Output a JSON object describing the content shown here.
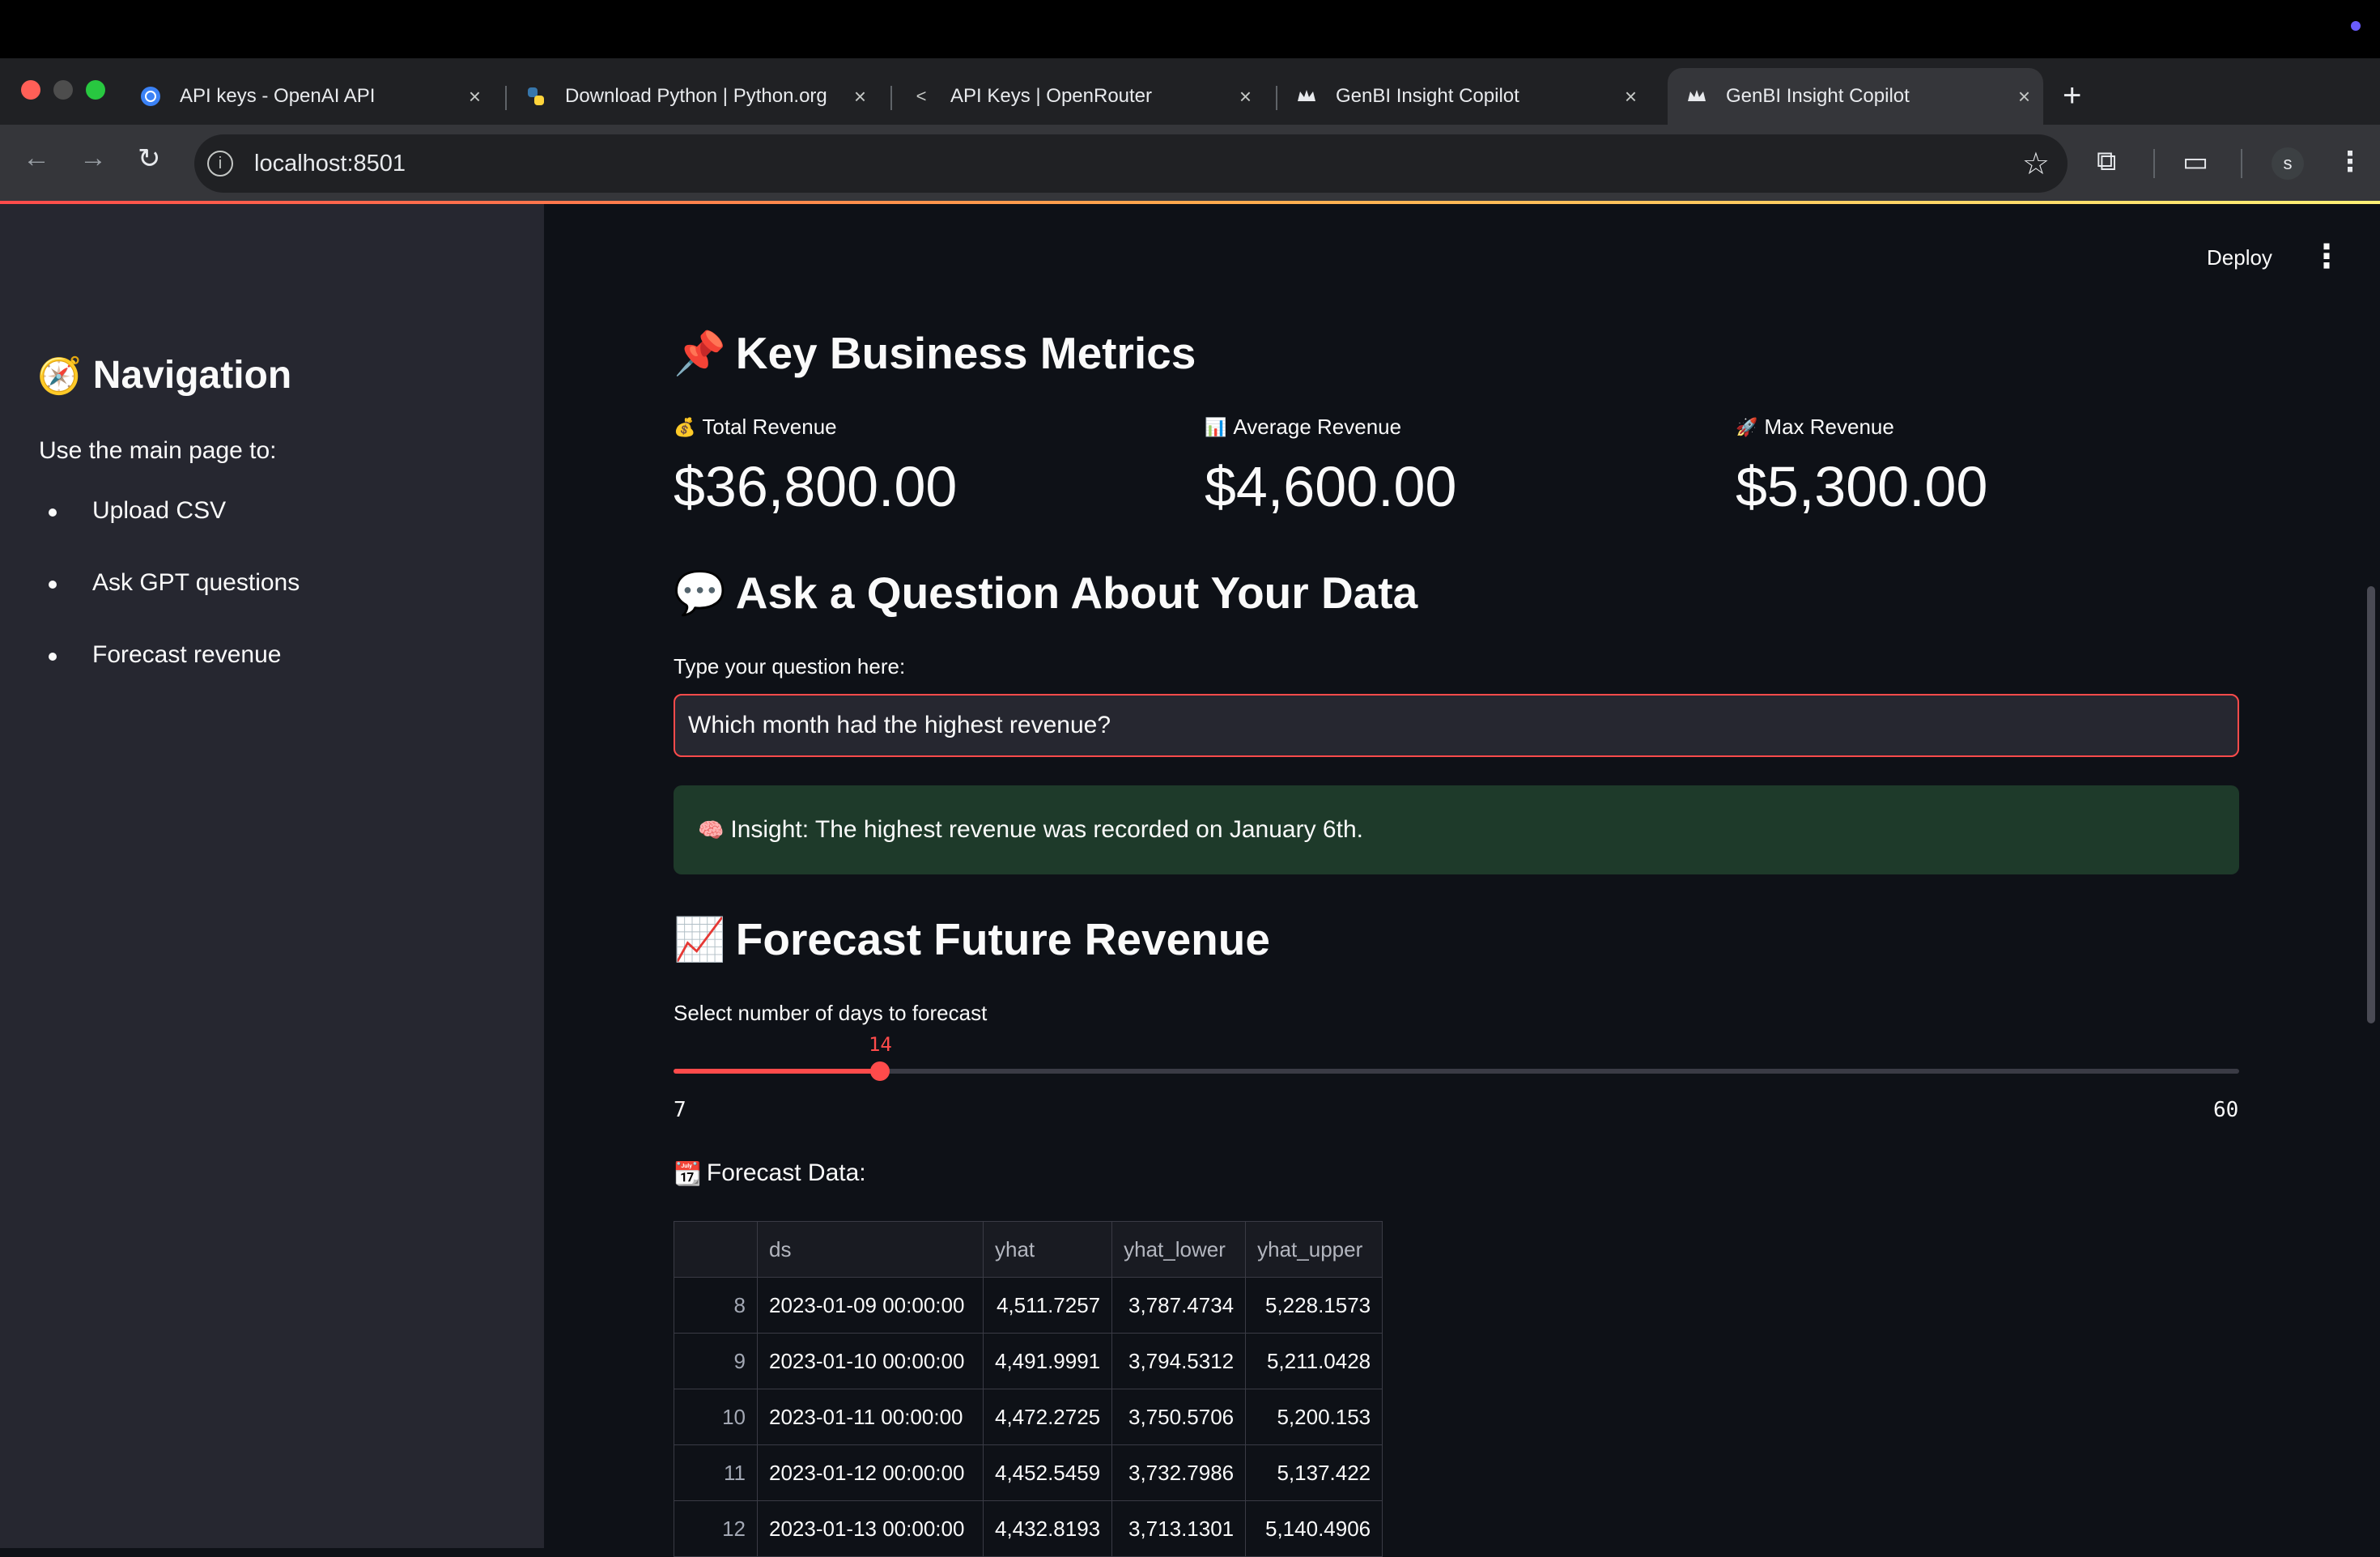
{
  "browser": {
    "tabs": [
      {
        "title": "API keys - OpenAI API",
        "icon": "openai-icon"
      },
      {
        "title": "Download Python | Python.org",
        "icon": "python-icon"
      },
      {
        "title": "API Keys | OpenRouter",
        "icon": "openrouter-icon"
      },
      {
        "title": "GenBI Insight Copilot",
        "icon": "streamlit-crown-icon"
      },
      {
        "title": "GenBI Insight Copilot",
        "icon": "streamlit-crown-icon",
        "active": true
      }
    ],
    "url": "localhost:8501",
    "profile_initial": "s"
  },
  "header": {
    "deploy_label": "Deploy"
  },
  "sidebar": {
    "title": "Navigation",
    "title_icon": "🧭",
    "intro": "Use the main page to:",
    "items": [
      "Upload CSV",
      "Ask GPT questions",
      "Forecast revenue"
    ]
  },
  "metrics": {
    "heading": "Key Business Metrics",
    "heading_icon": "📌",
    "items": [
      {
        "icon": "💰",
        "label": "Total Revenue",
        "value": "$36,800.00"
      },
      {
        "icon": "📊",
        "label": "Average Revenue",
        "value": "$4,600.00"
      },
      {
        "icon": "🚀",
        "label": "Max Revenue",
        "value": "$5,300.00"
      }
    ]
  },
  "question": {
    "heading": "Ask a Question About Your Data",
    "heading_icon": "💬",
    "label": "Type your question here:",
    "value": "Which month had the highest revenue?",
    "insight_icon": "🧠",
    "insight": "Insight: The highest revenue was recorded on January 6th."
  },
  "forecast": {
    "heading": "Forecast Future Revenue",
    "heading_icon": "📈",
    "slider_label": "Select number of days to forecast",
    "slider": {
      "min": 7,
      "max": 60,
      "value": 14
    },
    "slider_min_text": "7",
    "slider_max_text": "60",
    "slider_value_text": "14",
    "data_label_icon": "📆",
    "data_label": "Forecast Data:",
    "columns": [
      "ds",
      "yhat",
      "yhat_lower",
      "yhat_upper"
    ],
    "rows": [
      {
        "idx": "8",
        "ds": "2023-01-09 00:00:00",
        "yhat": "4,511.7257",
        "yhat_lower": "3,787.4734",
        "yhat_upper": "5,228.1573"
      },
      {
        "idx": "9",
        "ds": "2023-01-10 00:00:00",
        "yhat": "4,491.9991",
        "yhat_lower": "3,794.5312",
        "yhat_upper": "5,211.0428"
      },
      {
        "idx": "10",
        "ds": "2023-01-11 00:00:00",
        "yhat": "4,472.2725",
        "yhat_lower": "3,750.5706",
        "yhat_upper": "5,200.153"
      },
      {
        "idx": "11",
        "ds": "2023-01-12 00:00:00",
        "yhat": "4,452.5459",
        "yhat_lower": "3,732.7986",
        "yhat_upper": "5,137.422"
      },
      {
        "idx": "12",
        "ds": "2023-01-13 00:00:00",
        "yhat": "4,432.8193",
        "yhat_lower": "3,713.1301",
        "yhat_upper": "5,140.4906"
      }
    ]
  },
  "colors": {
    "accent": "#ff4b4b",
    "background": "#0e1117",
    "sidebar": "#262730",
    "insight_bg": "#1e3a2a"
  }
}
